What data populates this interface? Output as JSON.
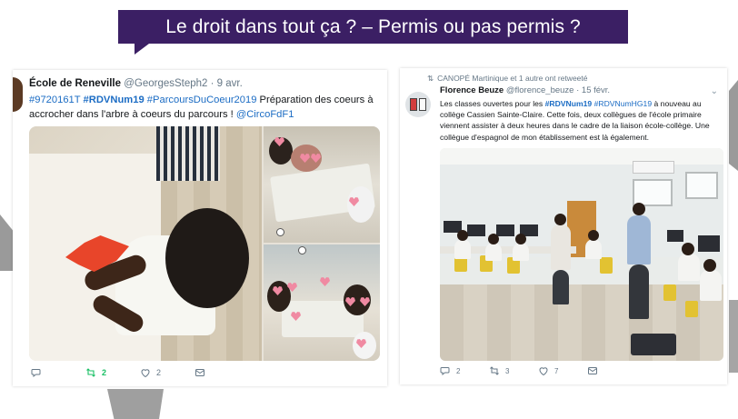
{
  "slide": {
    "title": "Le droit dans tout ça ? – Permis ou pas permis ?"
  },
  "tweet_left": {
    "author": "École de Reneville",
    "handle": "@GeorgesSteph2",
    "date": "· 9 avr.",
    "text_hashtag1": "#9720161T",
    "text_hashtag2": "#RDVNum19",
    "text_hashtag3": "#ParcoursDuCoeur2019",
    "text_body": " Préparation des coeurs à accrocher dans l'arbre à coeurs du parcours ! ",
    "text_mention": "@CircoFdF1",
    "actions": {
      "reply": "",
      "retweet": "2",
      "like": "2",
      "share": ""
    },
    "colors": {
      "retweet": "#17bf63",
      "link": "#1b6cc4"
    }
  },
  "tweet_right": {
    "retweet_context": "CANOPÉ Martinique et 1 autre ont retweeté",
    "author": "Florence Beuze",
    "handle": "@florence_beuze",
    "date": "· 15 févr.",
    "text_part1": "Les classes ouvertes pour les ",
    "text_hashtag1": "#RDVNum19",
    "text_hashtag2": "#RDVNumHG19",
    "text_part2": " à nouveau au collège Cassien Sainte-Claire. Cette fois, deux collègues de l'école primaire viennent assister à deux heures dans le cadre de la liaison école-collège. Une collègue d'espagnol de mon établissement est là également.",
    "actions": {
      "reply": "2",
      "retweet": "3",
      "like": "7",
      "share": ""
    }
  },
  "colors": {
    "banner": "#3b1f64",
    "banner_text": "#ffffff"
  },
  "icons": [
    "reply-icon",
    "retweet-icon",
    "like-icon",
    "share-icon",
    "chevron-down-icon",
    "canope-book-icon"
  ]
}
